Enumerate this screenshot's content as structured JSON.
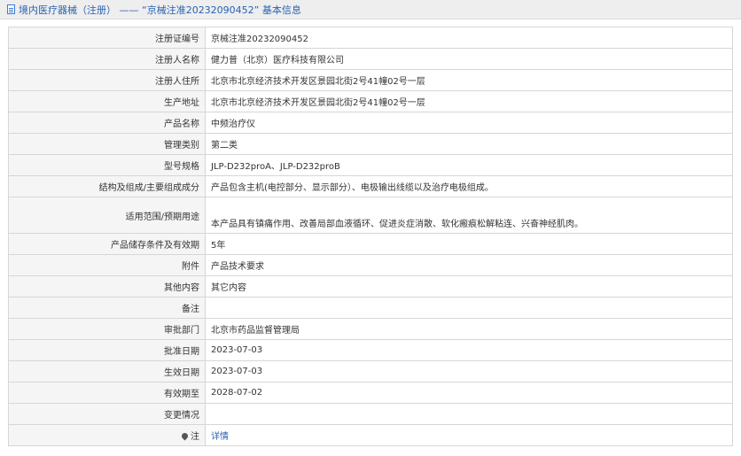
{
  "header": {
    "title": "境内医疗器械（注册） —— “京械注准20232090452” 基本信息"
  },
  "rows": [
    {
      "label": "注册证编号",
      "value": "京械注准20232090452"
    },
    {
      "label": "注册人名称",
      "value": "健力普（北京）医疗科技有限公司"
    },
    {
      "label": "注册人住所",
      "value": "北京市北京经济技术开发区景园北街2号41幢02号一层"
    },
    {
      "label": "生产地址",
      "value": "北京市北京经济技术开发区景园北街2号41幢02号一层"
    },
    {
      "label": "产品名称",
      "value": "中频治疗仪"
    },
    {
      "label": "管理类别",
      "value": "第二类"
    },
    {
      "label": "型号规格",
      "value": "JLP-D232proA、JLP-D232proB"
    },
    {
      "label": "结构及组成/主要组成成分",
      "value": "产品包含主机(电控部分、显示部分）、电极输出线缆以及治疗电极组成。"
    },
    {
      "label": "适用范围/预期用途",
      "value": "本产品具有镇痛作用、改善局部血液循环、促进炎症消散、软化瘢痕松解粘连、兴奋神经肌肉。"
    },
    {
      "label": "产品储存条件及有效期",
      "value": "5年"
    },
    {
      "label": "附件",
      "value": "产品技术要求"
    },
    {
      "label": "其他内容",
      "value": "其它内容"
    },
    {
      "label": "备注",
      "value": ""
    },
    {
      "label": "审批部门",
      "value": "北京市药品监督管理局"
    },
    {
      "label": "批准日期",
      "value": "2023-07-03"
    },
    {
      "label": "生效日期",
      "value": "2023-07-03"
    },
    {
      "label": "有效期至",
      "value": "2028-07-02"
    },
    {
      "label": "变更情况",
      "value": ""
    }
  ],
  "note_row": {
    "label": "注",
    "icon": "pin-icon",
    "link": "详情"
  }
}
